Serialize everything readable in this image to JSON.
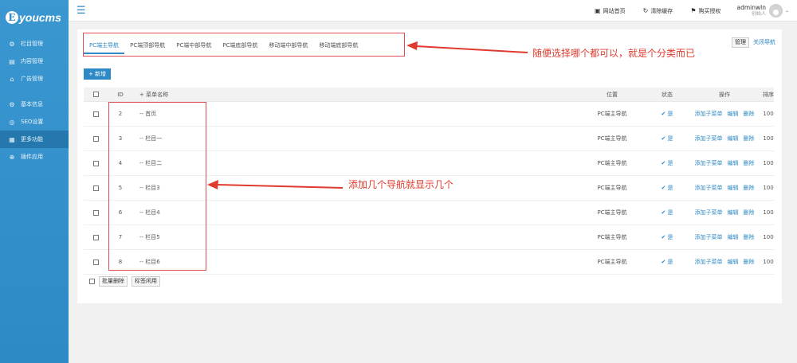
{
  "brand": {
    "mark": "E",
    "text": "youcms"
  },
  "sidebar": {
    "groups": [
      [
        {
          "icon": "gear-icon",
          "label": "栏目管理"
        },
        {
          "icon": "document-icon",
          "label": "内容管理"
        },
        {
          "icon": "home-icon",
          "label": "广告管理"
        }
      ],
      [
        {
          "icon": "settings-icon",
          "label": "基本信息"
        },
        {
          "icon": "seo-icon",
          "label": "SEO设置"
        },
        {
          "icon": "grid-icon",
          "label": "更多功能",
          "active": true
        },
        {
          "icon": "plugin-icon",
          "label": "插件应用"
        }
      ]
    ]
  },
  "topbar": {
    "links": [
      {
        "icon": "monitor-icon",
        "label": "网站首页"
      },
      {
        "icon": "refresh-icon",
        "label": "清除缓存"
      },
      {
        "icon": "bookmark-icon",
        "label": "购买授权"
      }
    ],
    "user": {
      "name": "adminwln",
      "role": "创始人"
    }
  },
  "tabs": [
    "PC端主导航",
    "PC端顶部导航",
    "PC端中部导航",
    "PC端底部导航",
    "移动端中部导航",
    "移动端底部导航"
  ],
  "actions": {
    "manage": "管理",
    "close_nav": "关闭导航",
    "add": "+ 新增"
  },
  "table": {
    "headers": {
      "id": "ID",
      "name": "+ 菜单名称",
      "position": "位置",
      "status": "状态",
      "ops": "操作",
      "sort": "排序"
    },
    "rows": [
      {
        "id": "2",
        "name": "-- 首页",
        "position": "PC端主导航",
        "status": "是",
        "sort": "100"
      },
      {
        "id": "3",
        "name": "-- 栏目一",
        "position": "PC端主导航",
        "status": "是",
        "sort": "100"
      },
      {
        "id": "4",
        "name": "-- 栏目二",
        "position": "PC端主导航",
        "status": "是",
        "sort": "100"
      },
      {
        "id": "5",
        "name": "-- 栏目3",
        "position": "PC端主导航",
        "status": "是",
        "sort": "100"
      },
      {
        "id": "6",
        "name": "-- 栏目4",
        "position": "PC端主导航",
        "status": "是",
        "sort": "100"
      },
      {
        "id": "7",
        "name": "-- 栏目5",
        "position": "PC端主导航",
        "status": "是",
        "sort": "100"
      },
      {
        "id": "8",
        "name": "-- 栏目6",
        "position": "PC端主导航",
        "status": "是",
        "sort": "100"
      }
    ],
    "ops": [
      "添加子菜单",
      "编辑",
      "删除"
    ]
  },
  "footer": {
    "batch_delete": "批量删除",
    "mark_unused": "标签闲用"
  },
  "annotations": {
    "tabs_note": "随便选择哪个都可以，就是个分类而已",
    "rows_note": "添加几个导航就显示几个"
  },
  "colors": {
    "primary": "#2e8ac6",
    "annotation": "#e03a2e"
  }
}
